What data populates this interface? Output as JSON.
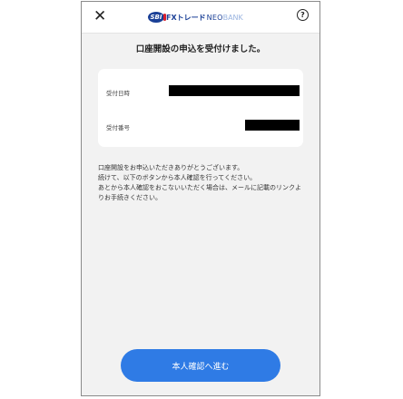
{
  "header": {
    "close_glyph": "✕",
    "logo": {
      "badge": "SBI",
      "fx": "FXトレード",
      "neo": "NEO",
      "bank": "BANK"
    },
    "help_glyph": "?"
  },
  "title": "口座開設の申込を受付けました。",
  "receipt": {
    "rows": [
      {
        "label": "受付日時"
      },
      {
        "label": "受付番号"
      }
    ]
  },
  "message": {
    "line1": "口座開設をお申込いただきありがとうございます。",
    "line2": "続けて、以下のボタンから本人確認を行ってください。",
    "line3": "あとから本人確認をおこないいただく場合は、メールに記載のリンクよりお手続きください。"
  },
  "primary_button": {
    "label": "本人確認へ進む"
  },
  "colors": {
    "accent": "#2f7be5",
    "brand_navy": "#1a3f96",
    "brand_red": "#d91e2b"
  }
}
